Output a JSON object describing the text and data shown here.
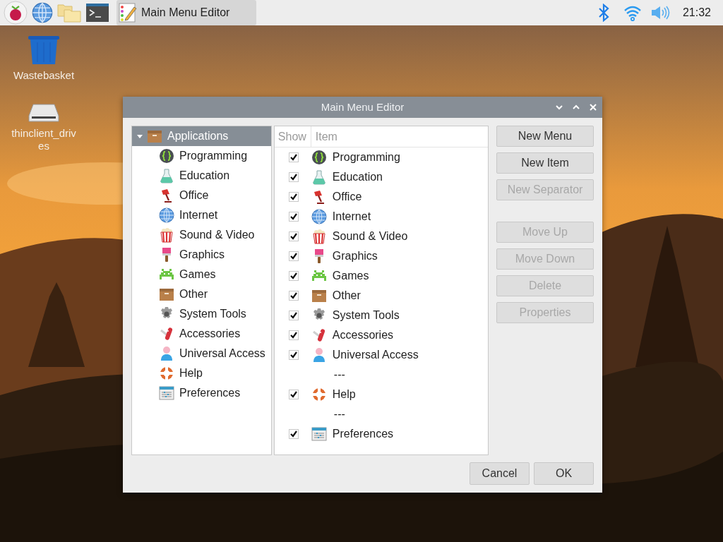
{
  "taskbar": {
    "task": {
      "title": "Main Menu Editor",
      "selected": true
    },
    "clock": "21:32"
  },
  "desktop_icons": [
    {
      "label": "Wastebasket"
    },
    {
      "label": "thinclient_drives"
    }
  ],
  "window": {
    "title": "Main Menu Editor",
    "tree": {
      "label": "Applications",
      "selected": true,
      "expanded": true,
      "children": [
        {
          "label": "Programming",
          "selected": false
        },
        {
          "label": "Education",
          "selected": false
        },
        {
          "label": "Office",
          "selected": false
        },
        {
          "label": "Internet",
          "selected": false
        },
        {
          "label": "Sound & Video",
          "selected": false
        },
        {
          "label": "Graphics",
          "selected": false
        },
        {
          "label": "Games",
          "selected": false
        },
        {
          "label": "Other",
          "selected": false
        },
        {
          "label": "System Tools",
          "selected": false
        },
        {
          "label": "Accessories",
          "selected": false
        },
        {
          "label": "Universal Access",
          "selected": false
        },
        {
          "label": "Help",
          "selected": false
        },
        {
          "label": "Preferences",
          "selected": false
        }
      ]
    },
    "list": {
      "columns": [
        "Show",
        "Item"
      ],
      "rows": [
        {
          "kind": "item",
          "label": "Programming",
          "checked": true
        },
        {
          "kind": "item",
          "label": "Education",
          "checked": true
        },
        {
          "kind": "item",
          "label": "Office",
          "checked": true
        },
        {
          "kind": "item",
          "label": "Internet",
          "checked": true
        },
        {
          "kind": "item",
          "label": "Sound & Video",
          "checked": true
        },
        {
          "kind": "item",
          "label": "Graphics",
          "checked": true
        },
        {
          "kind": "item",
          "label": "Games",
          "checked": true
        },
        {
          "kind": "item",
          "label": "Other",
          "checked": true
        },
        {
          "kind": "item",
          "label": "System Tools",
          "checked": true
        },
        {
          "kind": "item",
          "label": "Accessories",
          "checked": true
        },
        {
          "kind": "item",
          "label": "Universal Access",
          "checked": true
        },
        {
          "kind": "separator",
          "label": "---"
        },
        {
          "kind": "item",
          "label": "Help",
          "checked": true
        },
        {
          "kind": "separator",
          "label": "---"
        },
        {
          "kind": "item",
          "label": "Preferences",
          "checked": true
        }
      ]
    },
    "button_groups": [
      [
        {
          "label": "New Menu",
          "disabled": false
        },
        {
          "label": "New Item",
          "disabled": false
        },
        {
          "label": "New Separator",
          "disabled": true
        }
      ],
      [
        {
          "label": "Move Up",
          "disabled": true
        },
        {
          "label": "Move Down",
          "disabled": true
        },
        {
          "label": "Delete",
          "disabled": true
        },
        {
          "label": "Properties",
          "disabled": true
        }
      ]
    ],
    "footer_buttons": [
      "Cancel",
      "OK"
    ]
  }
}
